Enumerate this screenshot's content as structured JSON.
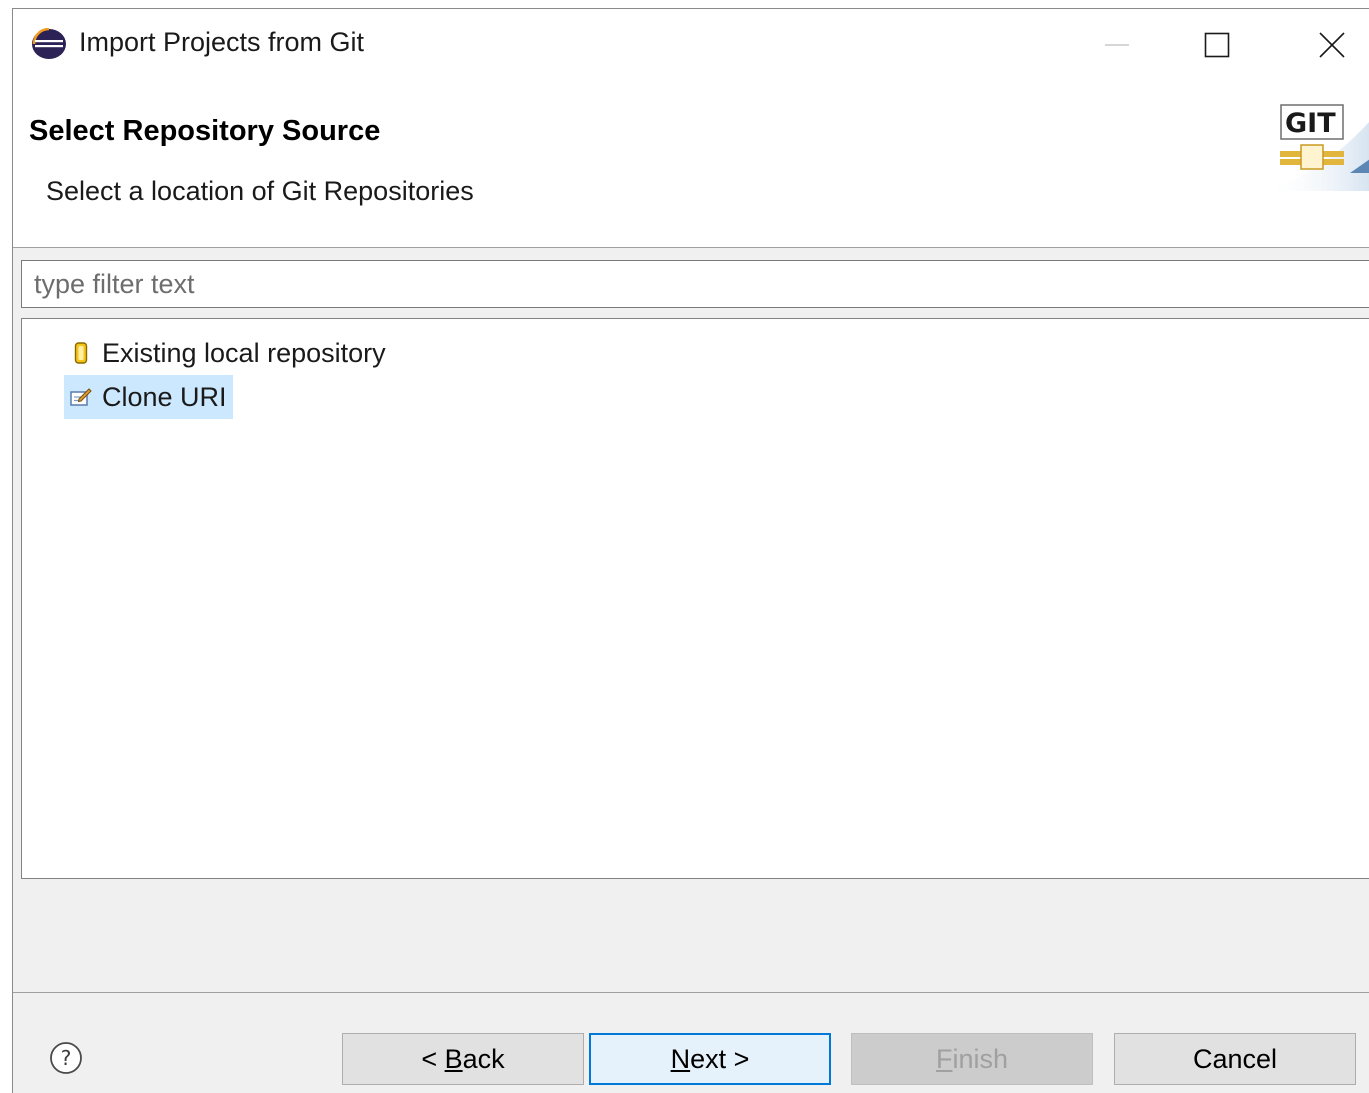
{
  "window": {
    "title": "Import Projects from Git"
  },
  "header": {
    "title": "Select Repository Source",
    "description": "Select a location of Git Repositories",
    "banner_text": "GIT"
  },
  "filter": {
    "placeholder": "type filter text",
    "value": ""
  },
  "tree": {
    "items": [
      {
        "label": "Existing local repository",
        "icon": "repository-icon",
        "selected": false
      },
      {
        "label": "Clone URI",
        "icon": "clone-uri-icon",
        "selected": true
      }
    ]
  },
  "buttons": {
    "back_prefix": "< ",
    "back_mnemonic": "B",
    "back_rest": "ack",
    "next_mnemonic": "N",
    "next_rest": "ext >",
    "finish_mnemonic": "F",
    "finish_rest": "inish",
    "cancel": "Cancel"
  },
  "colors": {
    "selection": "#cce8ff",
    "default_button_border": "#0078d7"
  }
}
